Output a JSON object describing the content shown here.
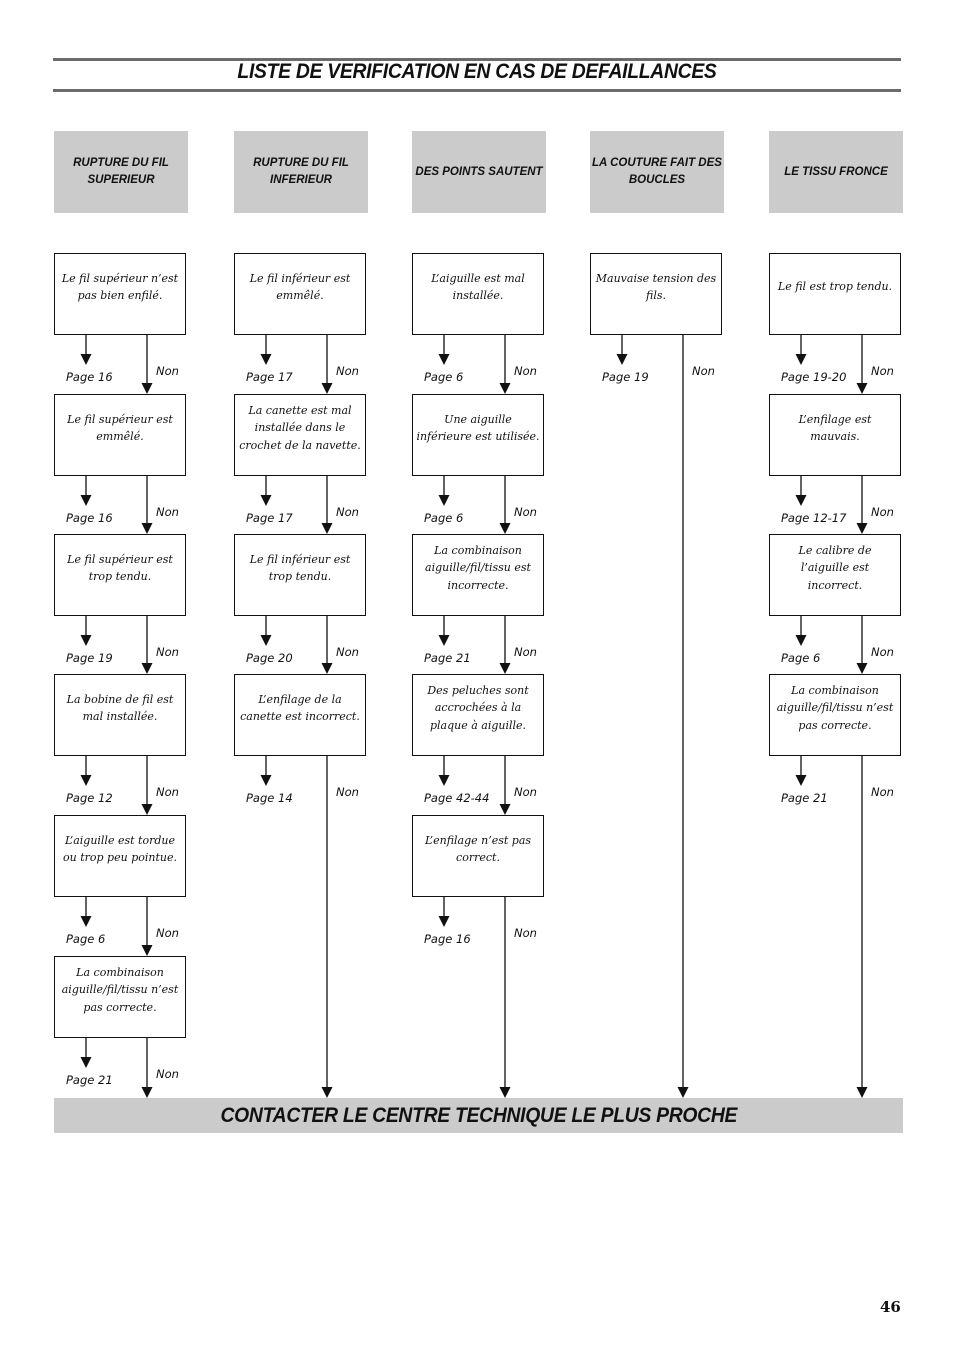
{
  "document": {
    "title": "LISTE DE VERIFICATION EN CAS DE DEFAILLANCES",
    "footer": "CONTACTER LE CENTRE TECHNIQUE LE PLUS PROCHE",
    "page_number": "46",
    "no_label": "Non",
    "colors": {
      "header_fill": "#cbcbcb",
      "rule": "#6b6b6b",
      "line": "#111111"
    }
  },
  "columns": [
    {
      "header": "RUPTURE DU FIL SUPERIEUR",
      "steps": [
        {
          "text": "Le fil supérieur n’est pas bien enfilé.",
          "page": "Page 16"
        },
        {
          "text": "Le fil supérieur est emmêlé.",
          "page": "Page 16"
        },
        {
          "text": "Le fil supérieur est trop tendu.",
          "page": "Page 19"
        },
        {
          "text": "La bobine de fil est mal installée.",
          "page": "Page 12"
        },
        {
          "text": "L’aiguille est tordue ou trop peu pointue.",
          "page": "Page 6"
        },
        {
          "text": "La combinaison aiguille/fil/tissu n’est pas correcte.",
          "page": "Page 21"
        }
      ]
    },
    {
      "header": "RUPTURE DU FIL INFERIEUR",
      "steps": [
        {
          "text": "Le fil inférieur est emmêlé.",
          "page": "Page 17"
        },
        {
          "text": "La canette est mal installée dans le crochet de la navette.",
          "page": "Page 17"
        },
        {
          "text": "Le fil inférieur est trop tendu.",
          "page": "Page 20"
        },
        {
          "text": "L’enfilage de la canette est incorrect.",
          "page": "Page 14"
        }
      ]
    },
    {
      "header": "DES POINTS SAUTENT",
      "steps": [
        {
          "text": "L’aiguille est mal installée.",
          "page": "Page 6"
        },
        {
          "text": "Une aiguille inférieure est utilisée.",
          "page": "Page 6"
        },
        {
          "text": "La combinaison aiguille/fil/tissu est incorrecte.",
          "page": "Page 21"
        },
        {
          "text": "Des peluches sont accrochées à la plaque à aiguille.",
          "page": "Page 42-44"
        },
        {
          "text": "L’enfilage n’est pas correct.",
          "page": "Page 16"
        }
      ]
    },
    {
      "header": "LA COUTURE FAIT DES BOUCLES",
      "steps": [
        {
          "text": "Mauvaise tension des fils.",
          "page": "Page 19"
        }
      ]
    },
    {
      "header": "LE TISSU FRONCE",
      "steps": [
        {
          "text": "Le fil est trop tendu.",
          "page": "Page 19-20"
        },
        {
          "text": "L’enfilage est mauvais.",
          "page": "Page 12-17"
        },
        {
          "text": "Le calibre de l’aiguille est incorrect.",
          "page": "Page 6"
        },
        {
          "text": "La combinaison aiguille/fil/tissu n’est pas correcte.",
          "page": "Page 21"
        }
      ]
    }
  ]
}
